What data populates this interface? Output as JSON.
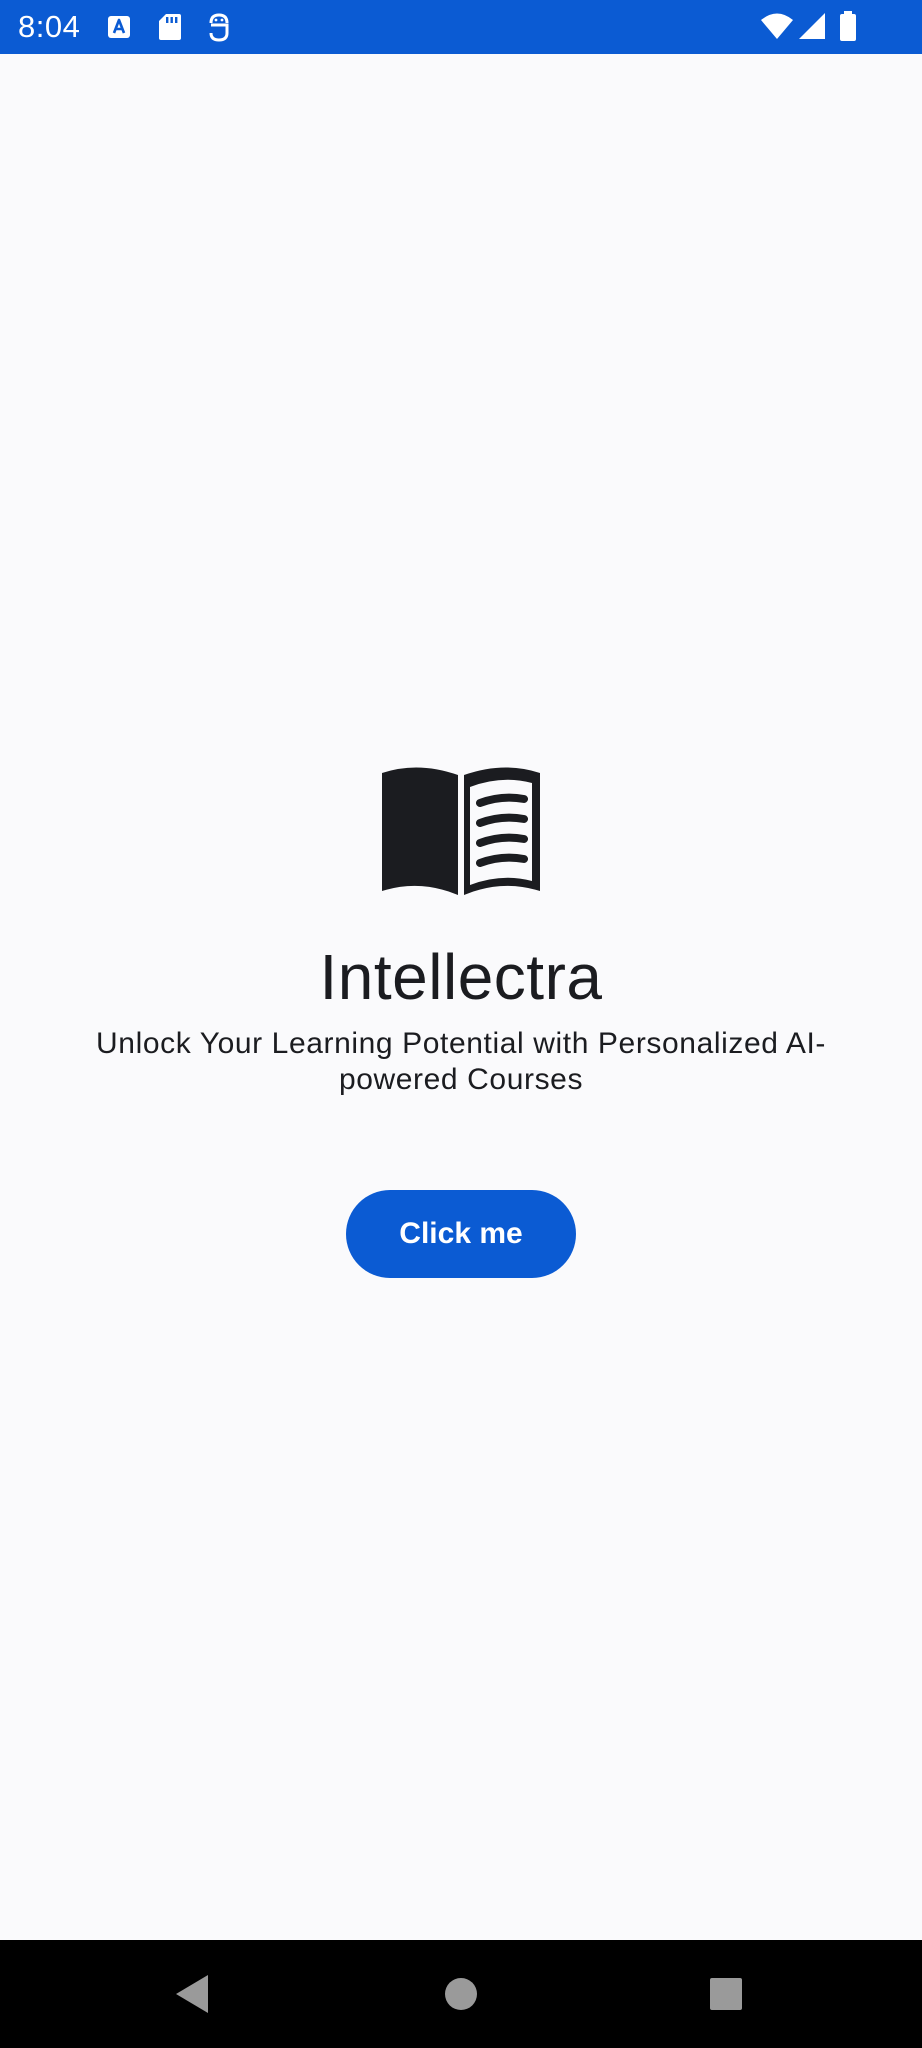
{
  "status_bar": {
    "time": "8:04",
    "icons": [
      "accessibility-a-icon",
      "sd-card-icon",
      "android-debug-icon",
      "wifi-icon",
      "signal-icon",
      "battery-icon"
    ],
    "background_color": "#0b5bd3"
  },
  "main": {
    "logo_icon": "open-book-icon",
    "title": "Intellectra",
    "subtitle": "Unlock Your Learning Potential with Personalized AI-powered Courses",
    "button_label": "Click me",
    "accent_color": "#0b5bd3",
    "background_color": "#fafafc"
  },
  "nav_bar": {
    "buttons": [
      "back-icon",
      "home-icon",
      "recents-icon"
    ]
  }
}
